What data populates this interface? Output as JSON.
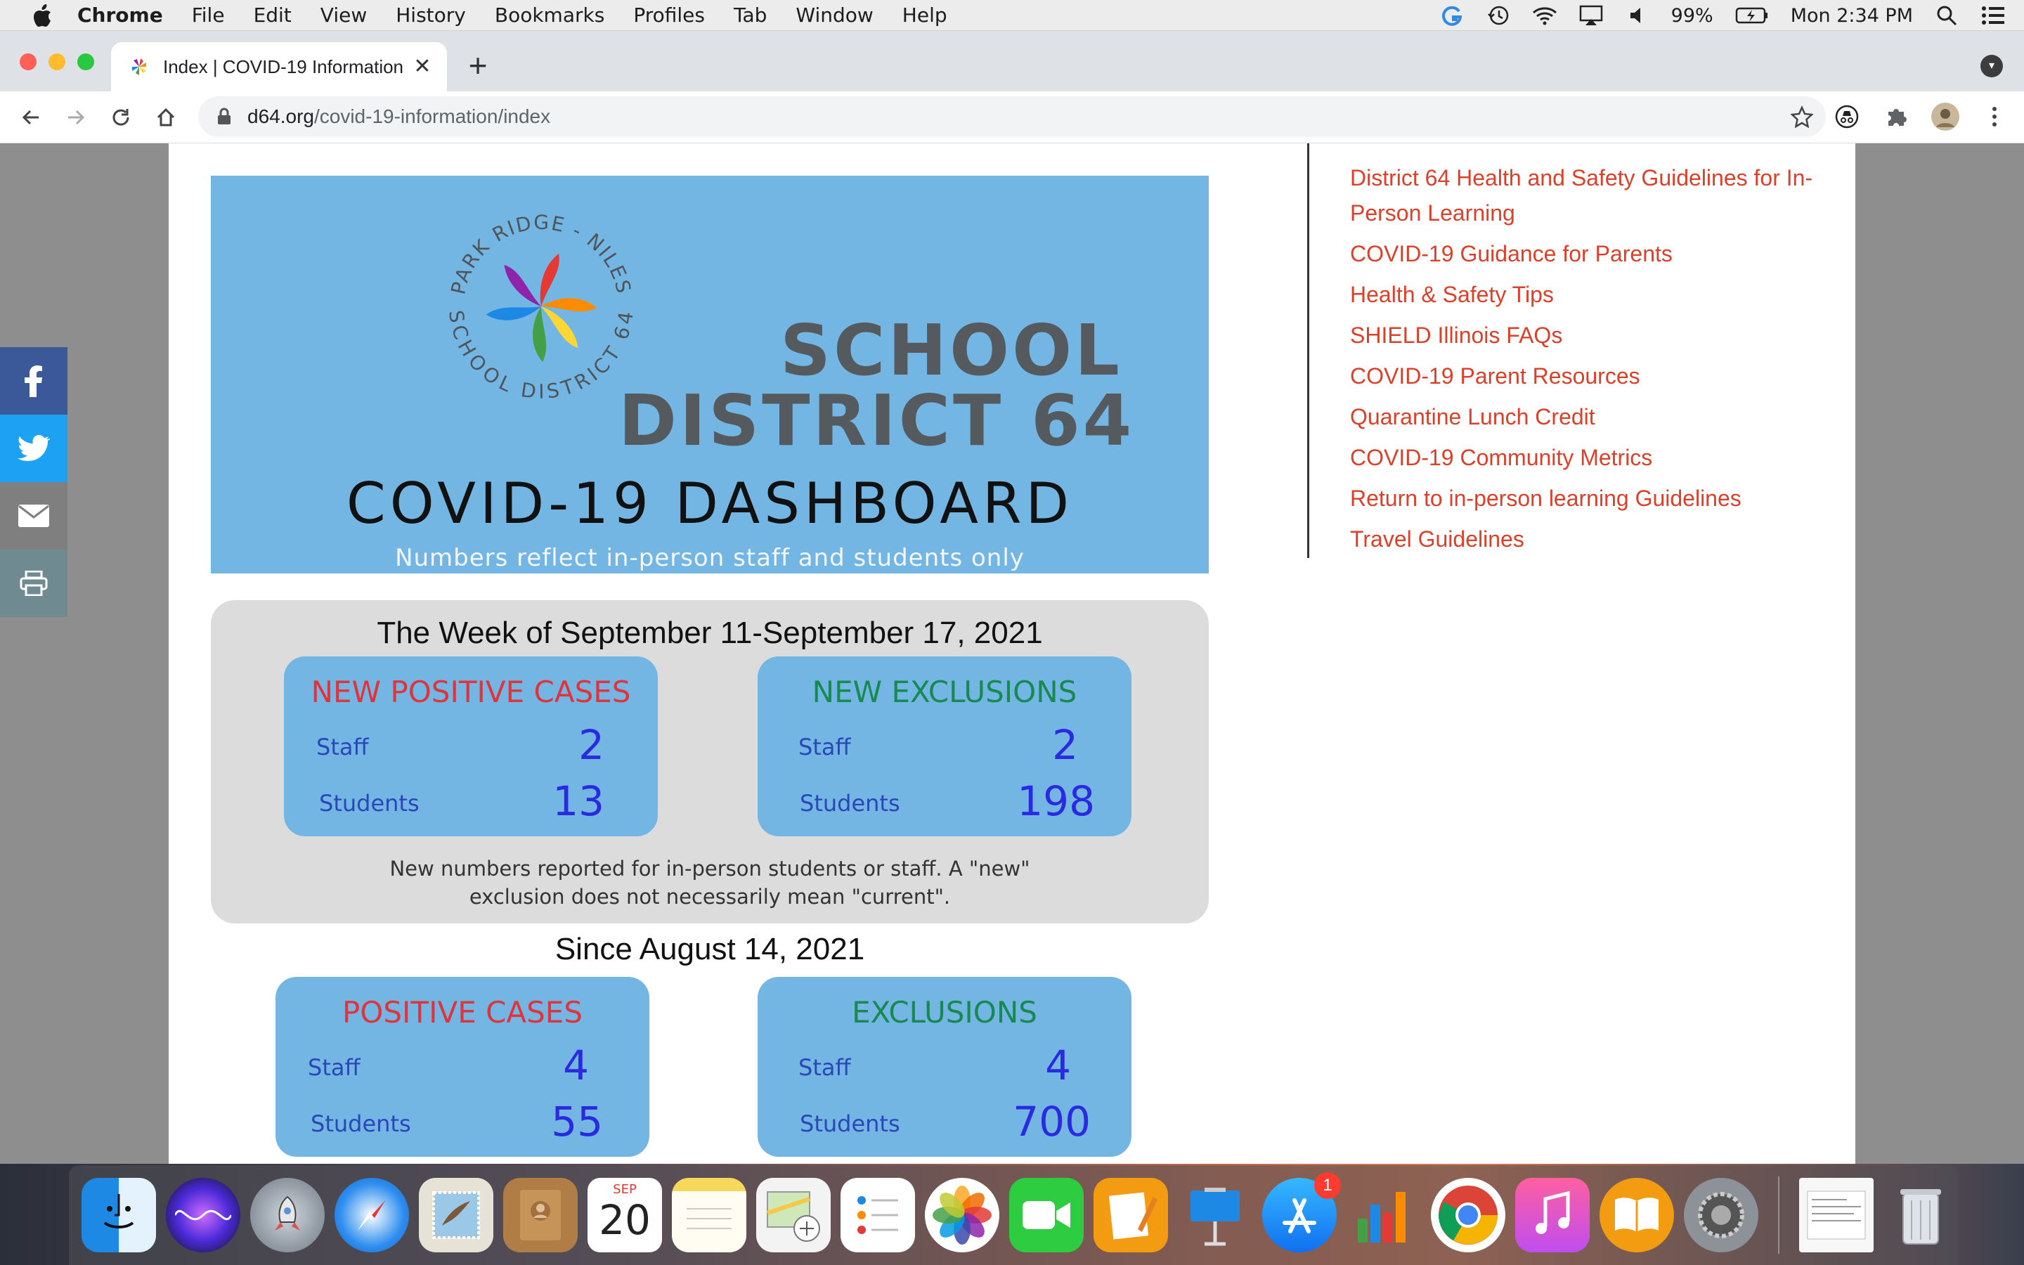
{
  "menubar": {
    "app": "Chrome",
    "items": [
      "File",
      "Edit",
      "View",
      "History",
      "Bookmarks",
      "Profiles",
      "Tab",
      "Window",
      "Help"
    ],
    "battery": "99%",
    "clock": "Mon 2:34 PM"
  },
  "browser": {
    "tab_title": "Index | COVID-19 Information",
    "url_host": "d64.org",
    "url_path": "/covid-19-information/index"
  },
  "banner": {
    "logo_ring_top": "PARK RIDGE - NILES",
    "logo_ring_bottom": "SCHOOL DISTRICT 64",
    "line1": "SCHOOL",
    "line2": "DISTRICT 64",
    "heading": "COVID-19 DASHBOARD",
    "note": "Numbers reflect in-person staff and students only"
  },
  "week": {
    "title": "The Week of September 11-September 17, 2021",
    "cases": {
      "title": "NEW POSITIVE CASES",
      "staff_label": "Staff",
      "staff": "2",
      "students_label": "Students",
      "students": "13"
    },
    "exclusions": {
      "title": "NEW EXCLUSIONS",
      "staff_label": "Staff",
      "staff": "2",
      "students_label": "Students",
      "students": "198"
    },
    "note_line1": "New numbers reported for in-person students or staff.  A \"new\"",
    "note_line2": "exclusion does not necessarily mean \"current\"."
  },
  "since": {
    "title": "Since August 14, 2021",
    "cases": {
      "title": "POSITIVE CASES",
      "staff_label": "Staff",
      "staff": "4",
      "students_label": "Students",
      "students": "55"
    },
    "exclusions": {
      "title": "EXCLUSIONS",
      "staff_label": "Staff",
      "staff": "4",
      "students_label": "Students",
      "students": "700"
    }
  },
  "sidebar_links": [
    "District 64 Health and Safety Guidelines for In-Person Learning",
    "COVID-19 Guidance for Parents",
    "Health & Safety Tips",
    "SHIELD Illinois FAQs",
    "COVID-19 Parent Resources",
    "Quarantine Lunch Credit",
    "COVID-19 Community Metrics",
    "Return to in-person learning Guidelines",
    "Travel Guidelines"
  ],
  "share": [
    "facebook-icon",
    "twitter-icon",
    "email-icon",
    "print-icon"
  ],
  "dock": {
    "calendar_month": "SEP",
    "calendar_day": "20",
    "appstore_badge": "1"
  },
  "colors": {
    "banner_blue": "#74b6e3",
    "link_red": "#d9412b",
    "case_red": "#e0343c",
    "exclusion_green": "#178a52",
    "facebook": "#3b5998",
    "twitter": "#1da1f2",
    "email": "#7f7f7f",
    "print": "#6f8a91"
  }
}
